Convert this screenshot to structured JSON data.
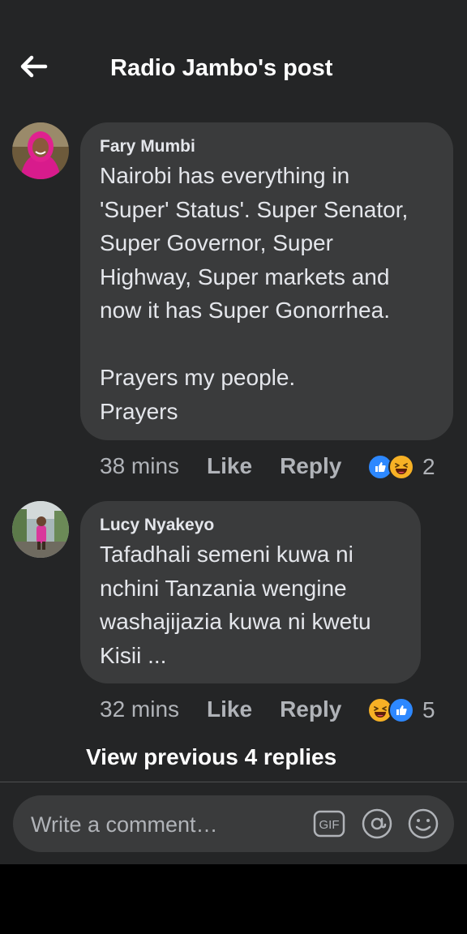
{
  "header": {
    "title": "Radio Jambo's post",
    "back_icon": "arrow-left-icon"
  },
  "comments": [
    {
      "author": "Fary Mumbi",
      "text": "Nairobi has everything in\n'Super' Status'. Super Senator,\nSuper Governor, Super\nHighway, Super markets and\nnow it has Super Gonorrhea.\n\nPrayers my people.\nPrayers",
      "time": "38 mins",
      "like_label": "Like",
      "reply_label": "Reply",
      "reactions": [
        "like-reaction-icon",
        "haha-reaction-icon"
      ],
      "reaction_count": "2"
    },
    {
      "author": "Lucy Nyakeyo",
      "text": "Tafadhali semeni kuwa ni\nnchini Tanzania wengine\nwashajijazia kuwa ni kwetu\nKisii ...",
      "time": "32 mins",
      "like_label": "Like",
      "reply_label": "Reply",
      "reactions": [
        "haha-reaction-icon",
        "like-reaction-icon"
      ],
      "reaction_count": "5"
    }
  ],
  "view_previous": "View previous 4 replies",
  "composer": {
    "placeholder": "Write a comment…",
    "gif_label": "GIF"
  },
  "colors": {
    "background": "#242526",
    "bubble": "#3a3b3c",
    "like_blue": "#2d88ff",
    "haha_yellow": "#f7b125"
  }
}
